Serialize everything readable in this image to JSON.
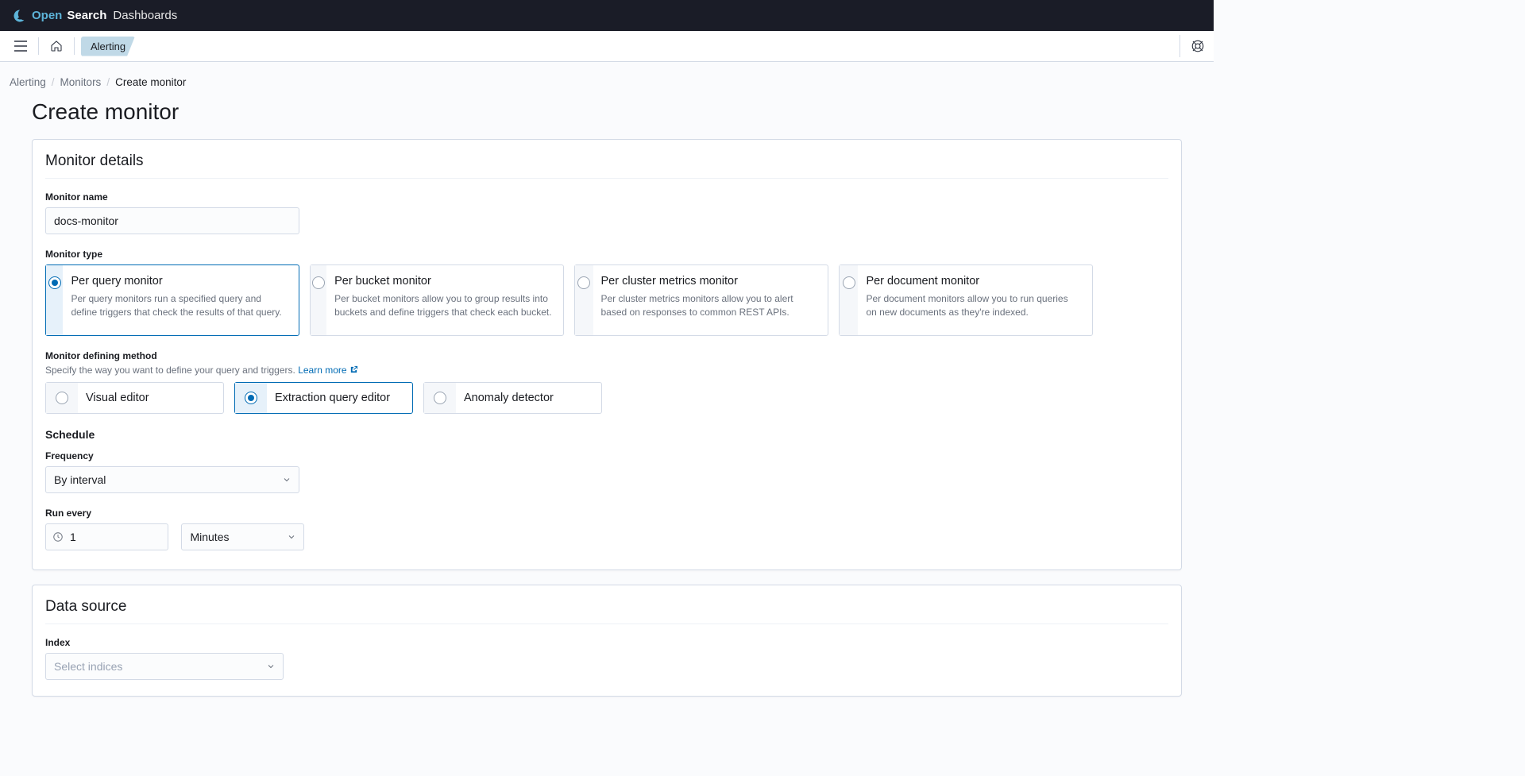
{
  "brand": {
    "open": "Open",
    "search": "Search",
    "dash": " Dashboards"
  },
  "subbar": {
    "crumb": "Alerting"
  },
  "breadcrumbs": {
    "a": "Alerting",
    "b": "Monitors",
    "c": "Create monitor"
  },
  "page": {
    "title": "Create monitor"
  },
  "panel1": {
    "title": "Monitor details",
    "name_label": "Monitor name",
    "name_value": "docs-monitor",
    "type_label": "Monitor type",
    "types": [
      {
        "title": "Per query monitor",
        "desc": "Per query monitors run a specified query and define triggers that check the results of that query."
      },
      {
        "title": "Per bucket monitor",
        "desc": "Per bucket monitors allow you to group results into buckets and define triggers that check each bucket."
      },
      {
        "title": "Per cluster metrics monitor",
        "desc": "Per cluster metrics monitors allow you to alert based on responses to common REST APIs."
      },
      {
        "title": "Per document monitor",
        "desc": "Per document monitors allow you to run queries on new documents as they're indexed."
      }
    ],
    "method_label": "Monitor defining method",
    "method_hint": "Specify the way you want to define your query and triggers. ",
    "method_learn": "Learn more",
    "methods": [
      {
        "title": "Visual editor"
      },
      {
        "title": "Extraction query editor"
      },
      {
        "title": "Anomaly detector"
      }
    ],
    "schedule_title": "Schedule",
    "freq_label": "Frequency",
    "freq_value": "By interval",
    "run_label": "Run every",
    "run_value": "1",
    "run_unit": "Minutes"
  },
  "panel2": {
    "title": "Data source",
    "index_label": "Index",
    "index_placeholder": "Select indices"
  }
}
